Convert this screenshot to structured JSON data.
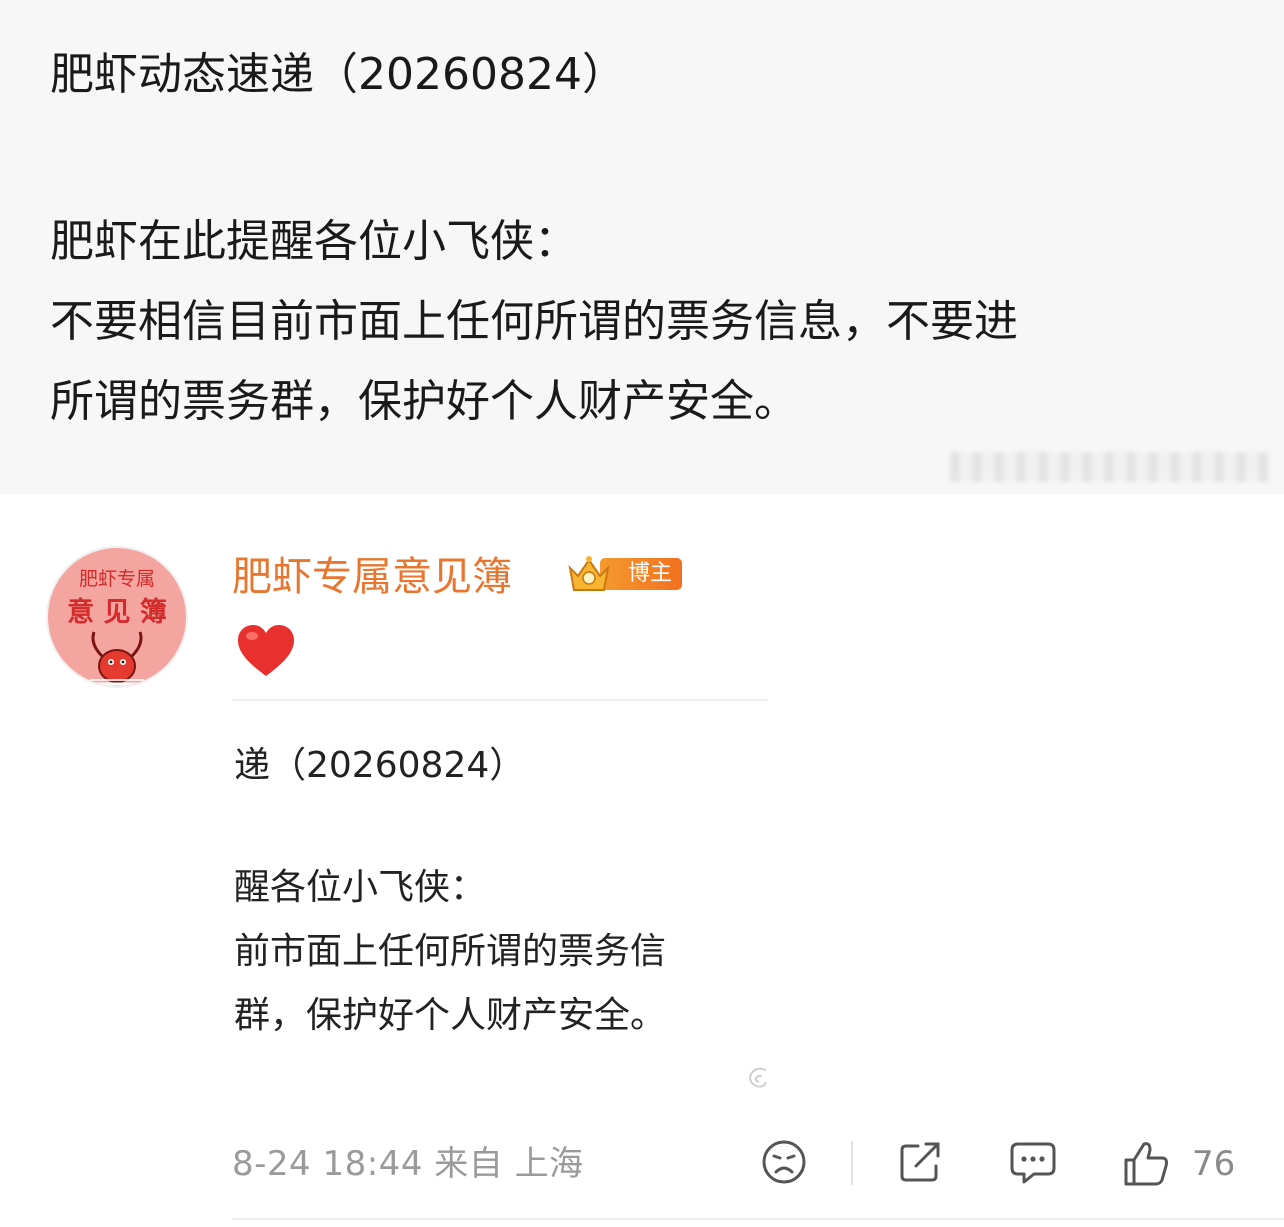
{
  "post": {
    "title": "肥虾动态速递（20260824）",
    "lines": [
      "肥虾在此提醒各位小飞侠：",
      "不要相信目前市面上任何所谓的票务信息，不要进",
      "所谓的票务群，保护好个人财产安全。"
    ]
  },
  "comment": {
    "avatar": {
      "top_text": "肥虾专属",
      "mid_text": "意 见 簿"
    },
    "username": "肥虾专属意见簿",
    "badge_label": "博主",
    "reaction_icon": "heart-icon",
    "quoted": {
      "title_fragment": "递（20260824）",
      "line1": "醒各位小飞侠：",
      "line2": "前市面上任何所谓的票务信",
      "line3": "群，保护好个人财产安全。"
    },
    "meta": {
      "date": "8-24",
      "time": "18:44",
      "source": "来自 上海"
    },
    "actions": {
      "icons": [
        "sad-face-icon",
        "share-icon",
        "comment-icon",
        "thumbs-up-icon"
      ],
      "like_count": "76"
    }
  },
  "colors": {
    "username": "#e8762f",
    "badge": "#f2701f",
    "heart": "#e8302e",
    "meta_text": "#9a9a9a"
  }
}
